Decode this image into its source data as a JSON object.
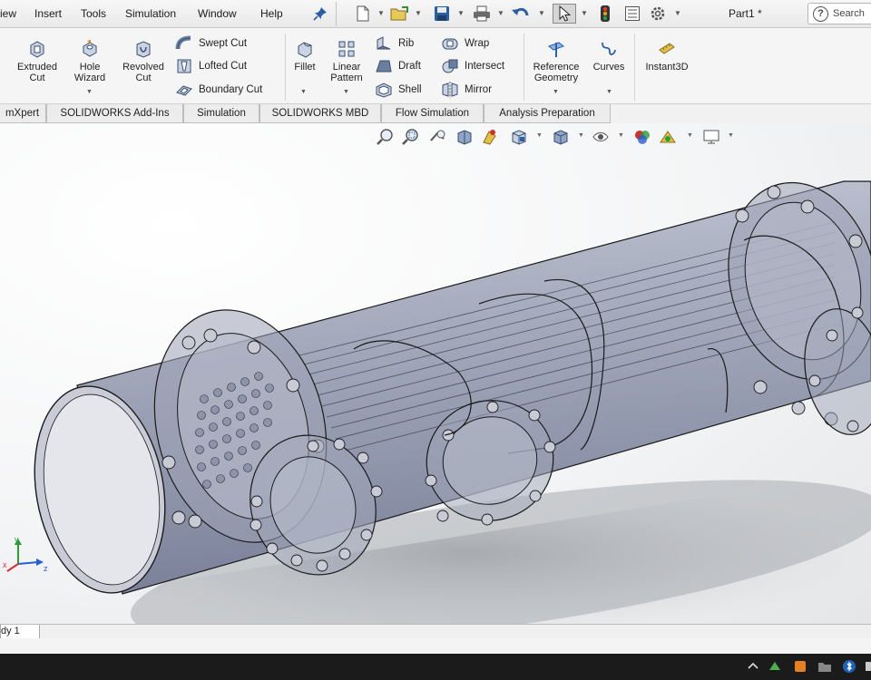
{
  "menu": {
    "items": [
      "iew",
      "Insert",
      "Tools",
      "Simulation",
      "Window",
      "Help"
    ]
  },
  "document": {
    "title": "Part1 *"
  },
  "search": {
    "label": "Search"
  },
  "ribbon": {
    "extruded_cut": "Extruded Cut",
    "hole_wizard": "Hole Wizard",
    "revolved_cut": "Revolved Cut",
    "swept_cut": "Swept Cut",
    "lofted_cut": "Lofted Cut",
    "boundary_cut": "Boundary Cut",
    "fillet": "Fillet",
    "linear_pattern": "Linear Pattern",
    "rib": "Rib",
    "draft": "Draft",
    "shell": "Shell",
    "wrap": "Wrap",
    "intersect": "Intersect",
    "mirror": "Mirror",
    "reference_geometry": "Reference Geometry",
    "curves": "Curves",
    "instant3d": "Instant3D"
  },
  "tabs": [
    "mXpert",
    "SOLIDWORKS Add-Ins",
    "Simulation",
    "SOLIDWORKS MBD",
    "Flow Simulation",
    "Analysis Preparation"
  ],
  "model_tabs": [
    "dy 1"
  ],
  "triad": {
    "x": "x",
    "y": "y",
    "z": "z"
  },
  "colors": {
    "accent": "#1f63b5",
    "model_body": "#9aa0b4",
    "model_edges": "#1a1a1a",
    "background": "#f4f5f6"
  },
  "icons": {
    "pin": "pin-icon",
    "new": "new-document-icon",
    "open": "open-icon",
    "save": "save-icon",
    "print": "print-icon",
    "undo": "undo-icon",
    "select": "select-cursor-icon",
    "rebuild": "traffic-light-icon",
    "file_props": "file-properties-icon",
    "options": "gear-icon"
  }
}
